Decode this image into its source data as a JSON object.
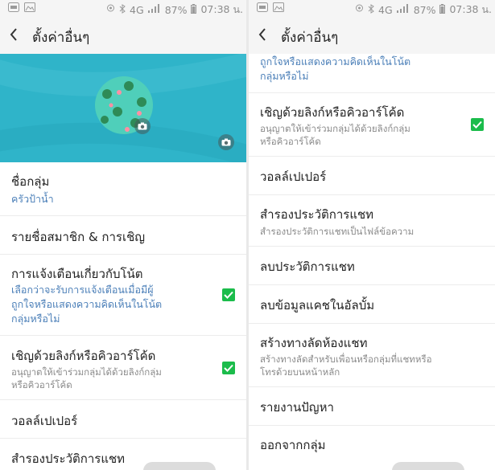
{
  "status_bar": {
    "battery": "87%",
    "time": "07:38 น.",
    "network": "4G"
  },
  "app_bar": {
    "title": "ตั้งค่าอื่นๆ"
  },
  "colors": {
    "cover": "#2fb4c9",
    "accent_blue": "#4b7fb8",
    "check_green": "#1bbc4b"
  },
  "left": {
    "group_name_label": "ชื่อกลุ่ม",
    "group_name_value": "ครัวป้าน้ำ",
    "members": "รายชื่อสมาชิก & การเชิญ",
    "notif_title": "การแจ้งเตือนเกี่ยวกับโน้ต",
    "notif_sub_1": "เลือกว่าจะรับการแจ้งเตือนเมื่อมีผู้",
    "notif_sub_2": "ถูกใจหรือแสดงความคิดเห็นในโน้ต",
    "notif_sub_3": "กลุ่มหรือไม่",
    "invite_title": "เชิญด้วยลิงก์หรือคิวอาร์โค้ด",
    "invite_sub_1": "อนุญาตให้เข้าร่วมกลุ่มได้ด้วยลิงก์กลุ่ม",
    "invite_sub_2": "หรือคิวอาร์โค้ด",
    "wallpaper": "วอลล์เปเปอร์",
    "backup": "สำรองประวัติการแชท"
  },
  "right": {
    "partial_1": "ถูกใจหรือแสดงความคิดเห็นในโน้ต",
    "partial_2": "กลุ่มหรือไม่",
    "invite_title": "เชิญด้วยลิงก์หรือคิวอาร์โค้ด",
    "invite_sub_1": "อนุญาตให้เข้าร่วมกลุ่มได้ด้วยลิงก์กลุ่ม",
    "invite_sub_2": "หรือคิวอาร์โค้ด",
    "wallpaper": "วอลล์เปเปอร์",
    "backup": "สำรองประวัติการแชท",
    "backup_sub": "สำรองประวัติการแชทเป็นไฟล์ข้อความ",
    "delete_history": "ลบประวัติการแชท",
    "delete_cache": "ลบข้อมูลแคชในอัลบั้ม",
    "shortcut": "สร้างทางลัดห้องแชท",
    "shortcut_sub_1": "สร้างทางลัดสำหรับเพื่อนหรือกลุ่มที่แชทหรือ",
    "shortcut_sub_2": "โทรด้วยบนหน้าหลัก",
    "report": "รายงานปัญหา",
    "leave": "ออกจากกลุ่ม"
  }
}
